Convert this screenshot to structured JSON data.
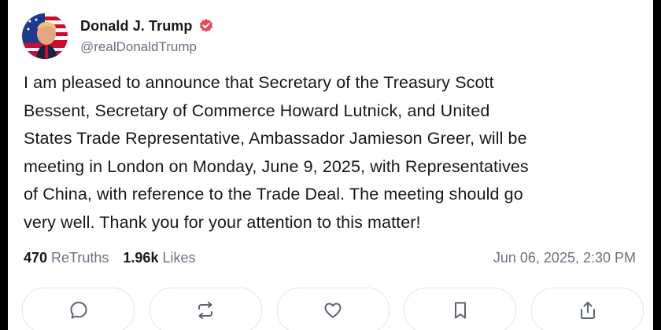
{
  "author": {
    "display_name": "Donald J. Trump",
    "handle": "@realDonaldTrump",
    "verified_icon": "verified-badge-icon",
    "verified_color": "#e8455b"
  },
  "post": {
    "text": "I am pleased to announce that Secretary of the Treasury Scott\nBessent, Secretary of Commerce Howard Lutnick, and United\nStates Trade Representative, Ambassador Jamieson Greer, will be\nmeeting in London on Monday, June 9, 2025, with Representatives\nof China, with reference to the Trade Deal. The meeting should go\nvery well. Thank you for your attention to this matter!"
  },
  "stats": {
    "retruths_count": "470",
    "retruths_label": "ReTruths",
    "likes_count": "1.96k",
    "likes_label": "Likes",
    "timestamp": "Jun 06, 2025, 2:30 PM"
  },
  "actions": [
    {
      "name": "reply",
      "icon": "comment-icon"
    },
    {
      "name": "retruth",
      "icon": "repost-icon"
    },
    {
      "name": "like",
      "icon": "heart-icon"
    },
    {
      "name": "bookmark",
      "icon": "bookmark-icon"
    },
    {
      "name": "share",
      "icon": "share-icon"
    }
  ],
  "colors": {
    "text": "#15171a",
    "muted": "#6b7280",
    "border": "#e3e5e8",
    "icon": "#5b6370"
  }
}
